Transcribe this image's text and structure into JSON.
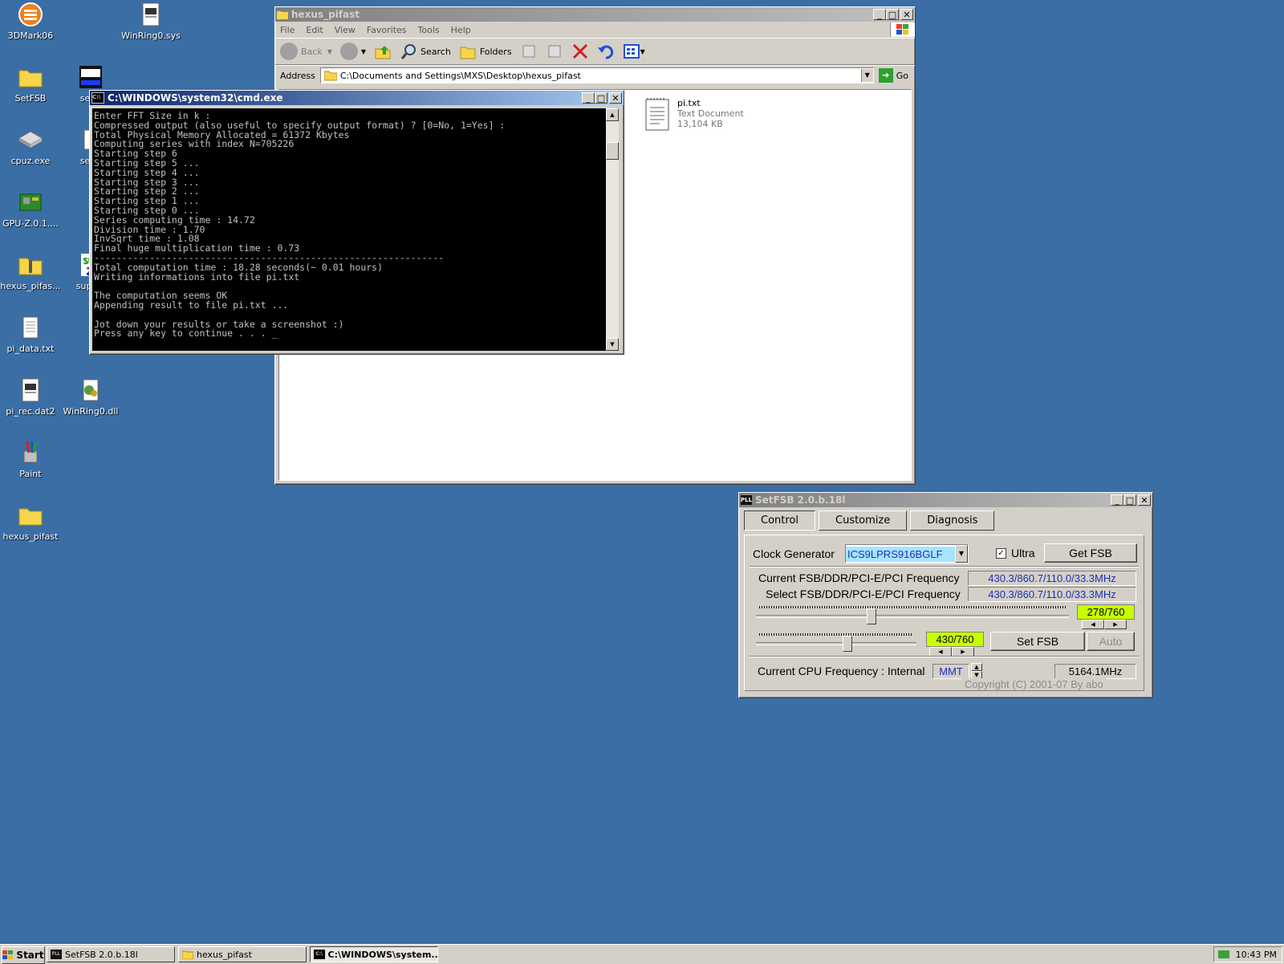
{
  "desktop": {
    "icons": [
      {
        "label": "3DMark06",
        "icon": "3dmark-icon"
      },
      {
        "label": "WinRing0.sys",
        "icon": "system-file-icon"
      },
      {
        "label": "SetFSB",
        "icon": "folder-icon"
      },
      {
        "label": "setfs",
        "icon": "pll-set-icon"
      },
      {
        "label": "cpuz.exe",
        "icon": "cpuz-icon"
      },
      {
        "label": "setfs",
        "icon": "file-icon"
      },
      {
        "label": "GPU-Z.0.1....",
        "icon": "gpuz-icon"
      },
      {
        "label": "hexus_pifas...",
        "icon": "zip-folder-icon"
      },
      {
        "label": "super_",
        "icon": "superpi-icon"
      },
      {
        "label": "pi_data.txt",
        "icon": "text-file-icon"
      },
      {
        "label": "pi_rec.dat2",
        "icon": "data-file-icon"
      },
      {
        "label": "WinRing0.dll",
        "icon": "dll-icon"
      },
      {
        "label": "Paint",
        "icon": "paint-icon"
      },
      {
        "label": "hexus_pifast",
        "icon": "folder-icon"
      }
    ]
  },
  "explorer": {
    "title": "hexus_pifast",
    "menu": [
      "File",
      "Edit",
      "View",
      "Favorites",
      "Tools",
      "Help"
    ],
    "toolbar": {
      "back": "Back",
      "search": "Search",
      "folders": "Folders"
    },
    "address_label": "Address",
    "address_value": "C:\\Documents and Settings\\MXS\\Desktop\\hexus_pifast",
    "go_label": "Go",
    "file": {
      "name": "pi.txt",
      "type": "Text Document",
      "size": "13,104 KB"
    }
  },
  "cmd": {
    "title": "C:\\WINDOWS\\system32\\cmd.exe",
    "lines": [
      "Enter FFT Size in k :",
      "Compressed output (also useful to specify output format) ? [0=No, 1=Yes] :",
      "Total Physical Memory Allocated = 61372 Kbytes",
      "Computing series with index N=705226",
      "Starting step 6",
      "Starting step 5 ...",
      "Starting step 4 ...",
      "Starting step 3 ...",
      "Starting step 2 ...",
      "Starting step 1 ...",
      "Starting step 0 ...",
      "Series computing time : 14.72",
      "Division time : 1.70",
      "InvSqrt time : 1.08",
      "Final huge multiplication time : 0.73",
      "---------------------------------------------------------------",
      "Total computation time : 18.28 seconds(~ 0.01 hours)",
      "Writing informations into file pi.txt",
      "",
      "The computation seems OK",
      "Appending result to file pi.txt ...",
      "",
      "Jot down your results or take a screenshot :)",
      "Press any key to continue . . . _"
    ]
  },
  "setfsb": {
    "title": "SetFSB 2.0.b.18l",
    "tabs": [
      "Control",
      "Customize",
      "Diagnosis"
    ],
    "clock_label": "Clock Generator",
    "clock_value": "ICS9LPRS916BGLF",
    "ultra_label": "Ultra",
    "ultra_checked": true,
    "get_fsb": "Get FSB",
    "current_label": "Current FSB/DDR/PCI-E/PCI Frequency",
    "current_value": "430.3/860.7/110.0/33.3MHz",
    "select_label": "Select FSB/DDR/PCI-E/PCI Frequency",
    "select_value": "430.3/860.7/110.0/33.3MHz",
    "slider1_value": "278/760",
    "slider1_fraction": 0.366,
    "slider2_value": "430/760",
    "slider2_fraction": 0.566,
    "set_fsb": "Set FSB",
    "auto": "Auto",
    "cpu_label": "Current CPU Frequency : Internal",
    "cpu_mode": "MMT",
    "cpu_value": "5164.1MHz",
    "copyright": "Copyright (C) 2001-07 By abo"
  },
  "taskbar": {
    "start": "Start",
    "items": [
      "SetFSB 2.0.b.18l",
      "hexus_pifast",
      "C:\\WINDOWS\\system..."
    ],
    "clock": "10:43 PM"
  }
}
